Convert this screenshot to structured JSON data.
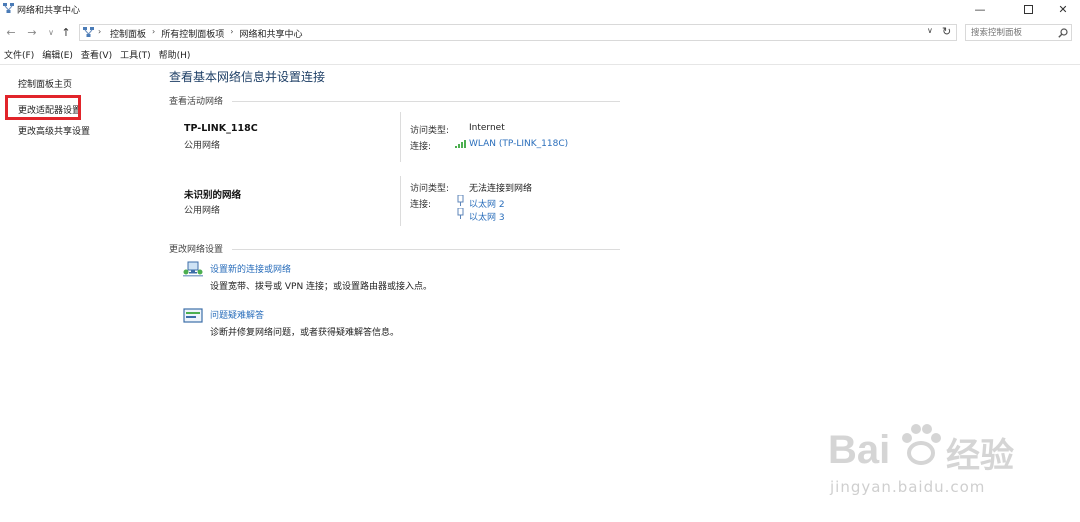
{
  "window": {
    "title": "网络和共享中心"
  },
  "breadcrumbs": [
    "控制面板",
    "所有控制面板项",
    "网络和共享中心"
  ],
  "search": {
    "placeholder": "搜索控制面板"
  },
  "menus": [
    "文件(F)",
    "编辑(E)",
    "查看(V)",
    "工具(T)",
    "帮助(H)"
  ],
  "sidebar": {
    "items": [
      "控制面板主页",
      "更改适配器设置",
      "更改高级共享设置"
    ]
  },
  "main": {
    "title": "查看基本网络信息并设置连接",
    "active_section": "查看活动网络",
    "networks": [
      {
        "name": "TP-LINK_118C",
        "type": "公用网络",
        "access_label": "访问类型:",
        "access_value": "Internet",
        "conn_label": "连接:",
        "connections": [
          "WLAN (TP-LINK_118C)"
        ]
      },
      {
        "name": "未识别的网络",
        "type": "公用网络",
        "access_label": "访问类型:",
        "access_value": "无法连接到网络",
        "conn_label": "连接:",
        "connections": [
          "以太网 2",
          "以太网 3"
        ]
      }
    ],
    "change_section": "更改网络设置",
    "tasks": [
      {
        "link": "设置新的连接或网络",
        "desc": "设置宽带、拨号或 VPN 连接；或设置路由器或接入点。"
      },
      {
        "link": "问题疑难解答",
        "desc": "诊断并修复网络问题，或者获得疑难解答信息。"
      }
    ]
  },
  "watermark": {
    "brand": "Bai",
    "brand2": "经验",
    "url": "jingyan.baidu.com"
  },
  "colors": {
    "accent_link": "#2a6ebb",
    "highlight_box": "#e1242a",
    "title": "#1e3f66"
  }
}
